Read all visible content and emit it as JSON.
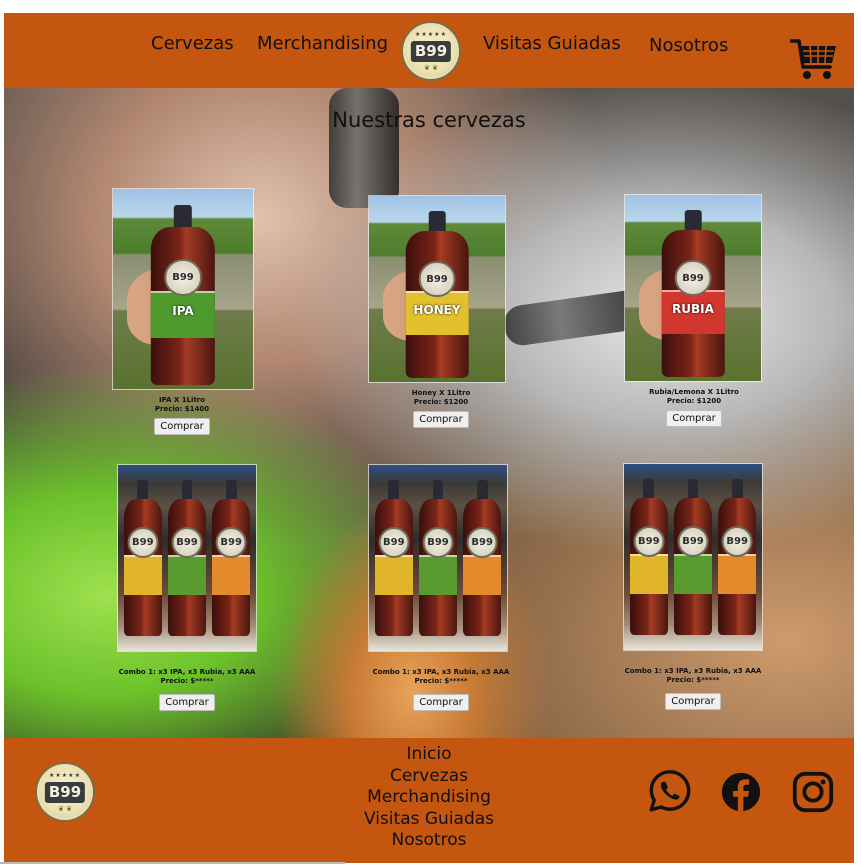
{
  "header": {
    "nav_left": [
      "Cervezas",
      "Merchandising"
    ],
    "nav_right": [
      "Visitas Guiadas",
      "Nosotros"
    ],
    "logo_text": "B99",
    "logo_stars": "★★★★★",
    "cart_icon": "cart-icon"
  },
  "main": {
    "title": "Nuestras cervezas",
    "products": [
      {
        "name": "IPA X 1Litro",
        "price": "Precio: $1400",
        "button": "Comprar",
        "label_text": "IPA",
        "label_color": "#4f9a2c"
      },
      {
        "name": "Honey X 1Litro",
        "price": "Precio: $1200",
        "button": "Comprar",
        "label_text": "HONEY",
        "label_color": "#e2c12d"
      },
      {
        "name": "Rubia/Lemona X 1Litro",
        "price": "Precio: $1200",
        "button": "Comprar",
        "label_text": "RUBIA",
        "label_color": "#d2372f"
      },
      {
        "name": "Combo 1: x3 IPA, x3 Rubia, x3 AAA",
        "price": "Precio: $*****",
        "button": "Comprar"
      },
      {
        "name": "Combo 1: x3 IPA, x3 Rubia, x3 AAA",
        "price": "Precio: $*****",
        "button": "Comprar"
      },
      {
        "name": "Combo 1: x3 IPA, x3 Rubia, x3 AAA",
        "price": "Precio: $*****",
        "button": "Comprar"
      }
    ],
    "combo_label_colors": [
      "#e0b52a",
      "#5a9b2f",
      "#e28a2c"
    ]
  },
  "footer": {
    "links": [
      "Inicio",
      "Cervezas",
      "Merchandising",
      "Visitas Guiadas",
      "Nosotros"
    ],
    "logo_text": "B99",
    "social_icons": [
      "whatsapp-icon",
      "facebook-icon",
      "instagram-icon"
    ]
  },
  "colors": {
    "brand_orange": "#c4560f",
    "button_bg": "#efefef"
  }
}
